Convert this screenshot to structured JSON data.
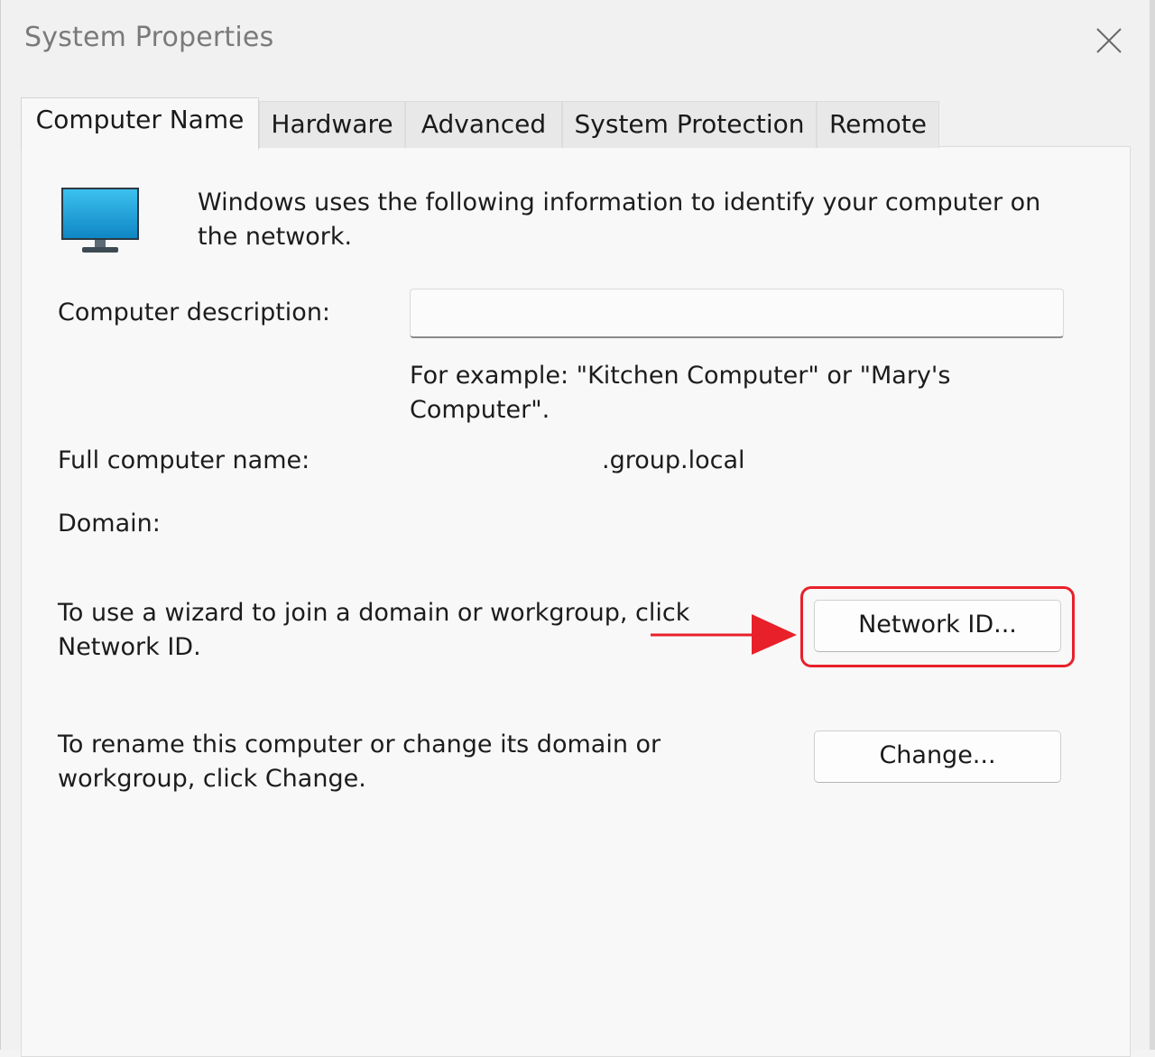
{
  "window": {
    "title": "System Properties",
    "close_icon": "close-icon"
  },
  "tabs": [
    {
      "label": "Computer Name",
      "active": true
    },
    {
      "label": "Hardware",
      "active": false
    },
    {
      "label": "Advanced",
      "active": false
    },
    {
      "label": "System Protection",
      "active": false
    },
    {
      "label": "Remote",
      "active": false
    }
  ],
  "intro": {
    "icon": "monitor-icon",
    "line1": "Windows uses the following information to identify your computer on",
    "line2": "the network."
  },
  "description": {
    "label": "Computer description:",
    "value": "",
    "hint_line1": "For example: \"Kitchen Computer\" or \"Mary's",
    "hint_line2": "Computer\"."
  },
  "full_name": {
    "label": "Full computer name:",
    "value": ".group.local"
  },
  "domain": {
    "label": "Domain:",
    "value": ""
  },
  "network_id": {
    "text_line1": "To use a wizard to join a domain or workgroup, click",
    "text_line2": "Network ID.",
    "button_label": "Network ID..."
  },
  "rename": {
    "text_line1": "To rename this computer or change its domain or",
    "text_line2": "workgroup, click Change.",
    "button_label": "Change..."
  },
  "colors": {
    "highlight": "#e8202a",
    "monitor_screen": "#1aa3d9"
  }
}
